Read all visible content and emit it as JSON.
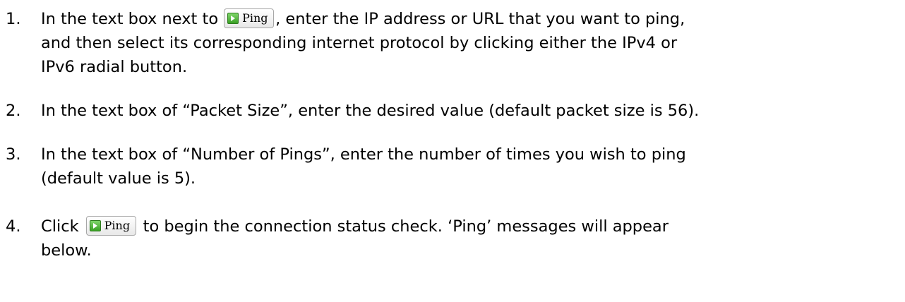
{
  "ping_button": {
    "label": "Ping"
  },
  "steps": [
    {
      "number": "1.",
      "line1_before": "In the text box next to",
      "line1_after": ", enter the IP address or URL that you want to ping,",
      "line2": "and then select its corresponding internet protocol by clicking either the IPv4 or",
      "line3": "IPv6 radial button."
    },
    {
      "number": "2.",
      "line1": "In the text box of “Packet Size”, enter the desired value (default packet size is 56)."
    },
    {
      "number": "3.",
      "line1": "In the text box of “Number of Pings”, enter the number of times you wish to ping",
      "line2": "(default value is 5)."
    },
    {
      "number": "4.",
      "line1_before": "Click",
      "line1_after": "to begin the connection status check. ‘Ping’ messages will appear",
      "line2": "below."
    }
  ]
}
